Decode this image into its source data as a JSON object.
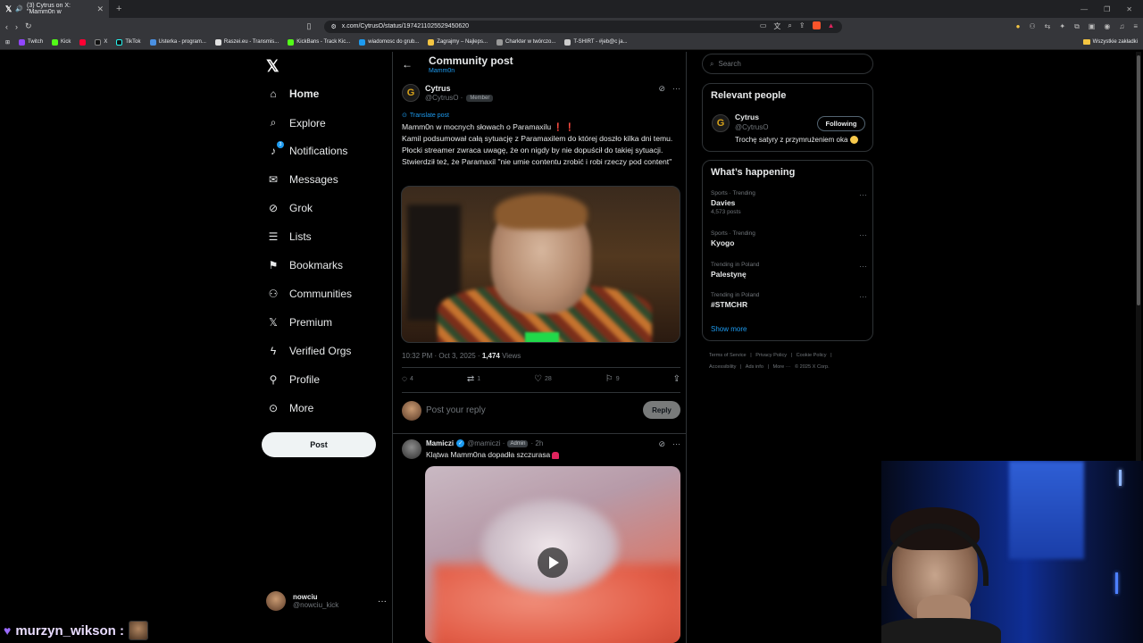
{
  "browser": {
    "tab_title": "(3) Cytrus on X: \"Mamm0n w",
    "url": "x.com/CytrusO/status/1974211025529450620",
    "bookmarks": [
      "Twitch",
      "Kick",
      "X",
      "TikTok",
      "Usterka - program...",
      "Raszei.eu - Transmis...",
      "KickBans - Track Kic...",
      "wiadomosc do grub...",
      "Zagrajmy – Najleps...",
      "Charkter w twórczo...",
      "T-SHIRT - #jeb@c ja..."
    ],
    "bookmarks_folder": "Wszystkie zakładki"
  },
  "nav": {
    "items": [
      {
        "label": "Home",
        "icon": "home-icon"
      },
      {
        "label": "Explore",
        "icon": "search-icon"
      },
      {
        "label": "Notifications",
        "icon": "bell-icon",
        "badge": "3"
      },
      {
        "label": "Messages",
        "icon": "envelope-icon"
      },
      {
        "label": "Grok",
        "icon": "grok-icon"
      },
      {
        "label": "Lists",
        "icon": "list-icon"
      },
      {
        "label": "Bookmarks",
        "icon": "bookmark-icon"
      },
      {
        "label": "Communities",
        "icon": "communities-icon"
      },
      {
        "label": "Premium",
        "icon": "x-logo-icon"
      },
      {
        "label": "Verified Orgs",
        "icon": "lightning-icon"
      },
      {
        "label": "Profile",
        "icon": "person-icon"
      },
      {
        "label": "More",
        "icon": "more-circle-icon"
      }
    ],
    "post_button": "Post",
    "user": {
      "name": "nowciu",
      "handle": "@nowciu_kick"
    }
  },
  "main": {
    "header_title": "Community post",
    "header_subtitle": "Mamm0n",
    "post": {
      "author": "Cytrus",
      "handle": "@CytrusO ·",
      "badge": "Member",
      "translate": "Translate post",
      "line1": "Mamm0n w mocnych słowach o Paramaxilu",
      "body": "Kamil podsumował całą sytuację z Paramaxilem do której doszło kilka dni temu. Płocki streamer zwraca uwagę, że on nigdy by nie dopuścił do takiej sytuacji. Stwierdził też, że Paramaxil \"nie umie contentu zrobić i robi rzeczy pod content\"",
      "timestamp": "10:32 PM · Oct 3, 2025 · ",
      "views_count": "1,474",
      "views_label": "Views",
      "replies": "4",
      "reposts": "1",
      "likes": "28",
      "bookmarks": "9"
    },
    "reply": {
      "placeholder": "Post your reply",
      "button": "Reply"
    },
    "post2": {
      "author": "Mamiczi",
      "handle": "@mamiczi ·",
      "badge": "Admin",
      "time": "· 2h",
      "text": "Klątwa Mamm0na dopadła szczurasa"
    }
  },
  "right": {
    "search_placeholder": "Search",
    "relevant_title": "Relevant people",
    "person": {
      "name": "Cytrus",
      "handle": "@CytrusO",
      "bio": "Trochę satyry z przymrużeniem oka",
      "follow": "Following"
    },
    "happening_title": "What’s happening",
    "trends": [
      {
        "category": "Sports · Trending",
        "name": "Davies",
        "count": "4,573 posts"
      },
      {
        "category": "Sports · Trending",
        "name": "Kyogo",
        "count": ""
      },
      {
        "category": "Trending in Poland",
        "name": "Palestynę",
        "count": ""
      },
      {
        "category": "Trending in Poland",
        "name": "#STMCHR",
        "count": ""
      }
    ],
    "show_more": "Show more",
    "footer": [
      "Terms of Service",
      "|",
      "Privacy Policy",
      "|",
      "Cookie Policy",
      "|",
      "Accessibility",
      "|",
      "Ads info",
      "|",
      "More ···",
      "© 2025 X Corp."
    ]
  },
  "chat": {
    "username": "murzyn_wikson",
    "separator": ":"
  },
  "colors": {
    "accent": "#1d9bf0",
    "background": "#000000",
    "text": "#e7e9ea",
    "muted": "#71767b",
    "border": "#2f3336"
  }
}
